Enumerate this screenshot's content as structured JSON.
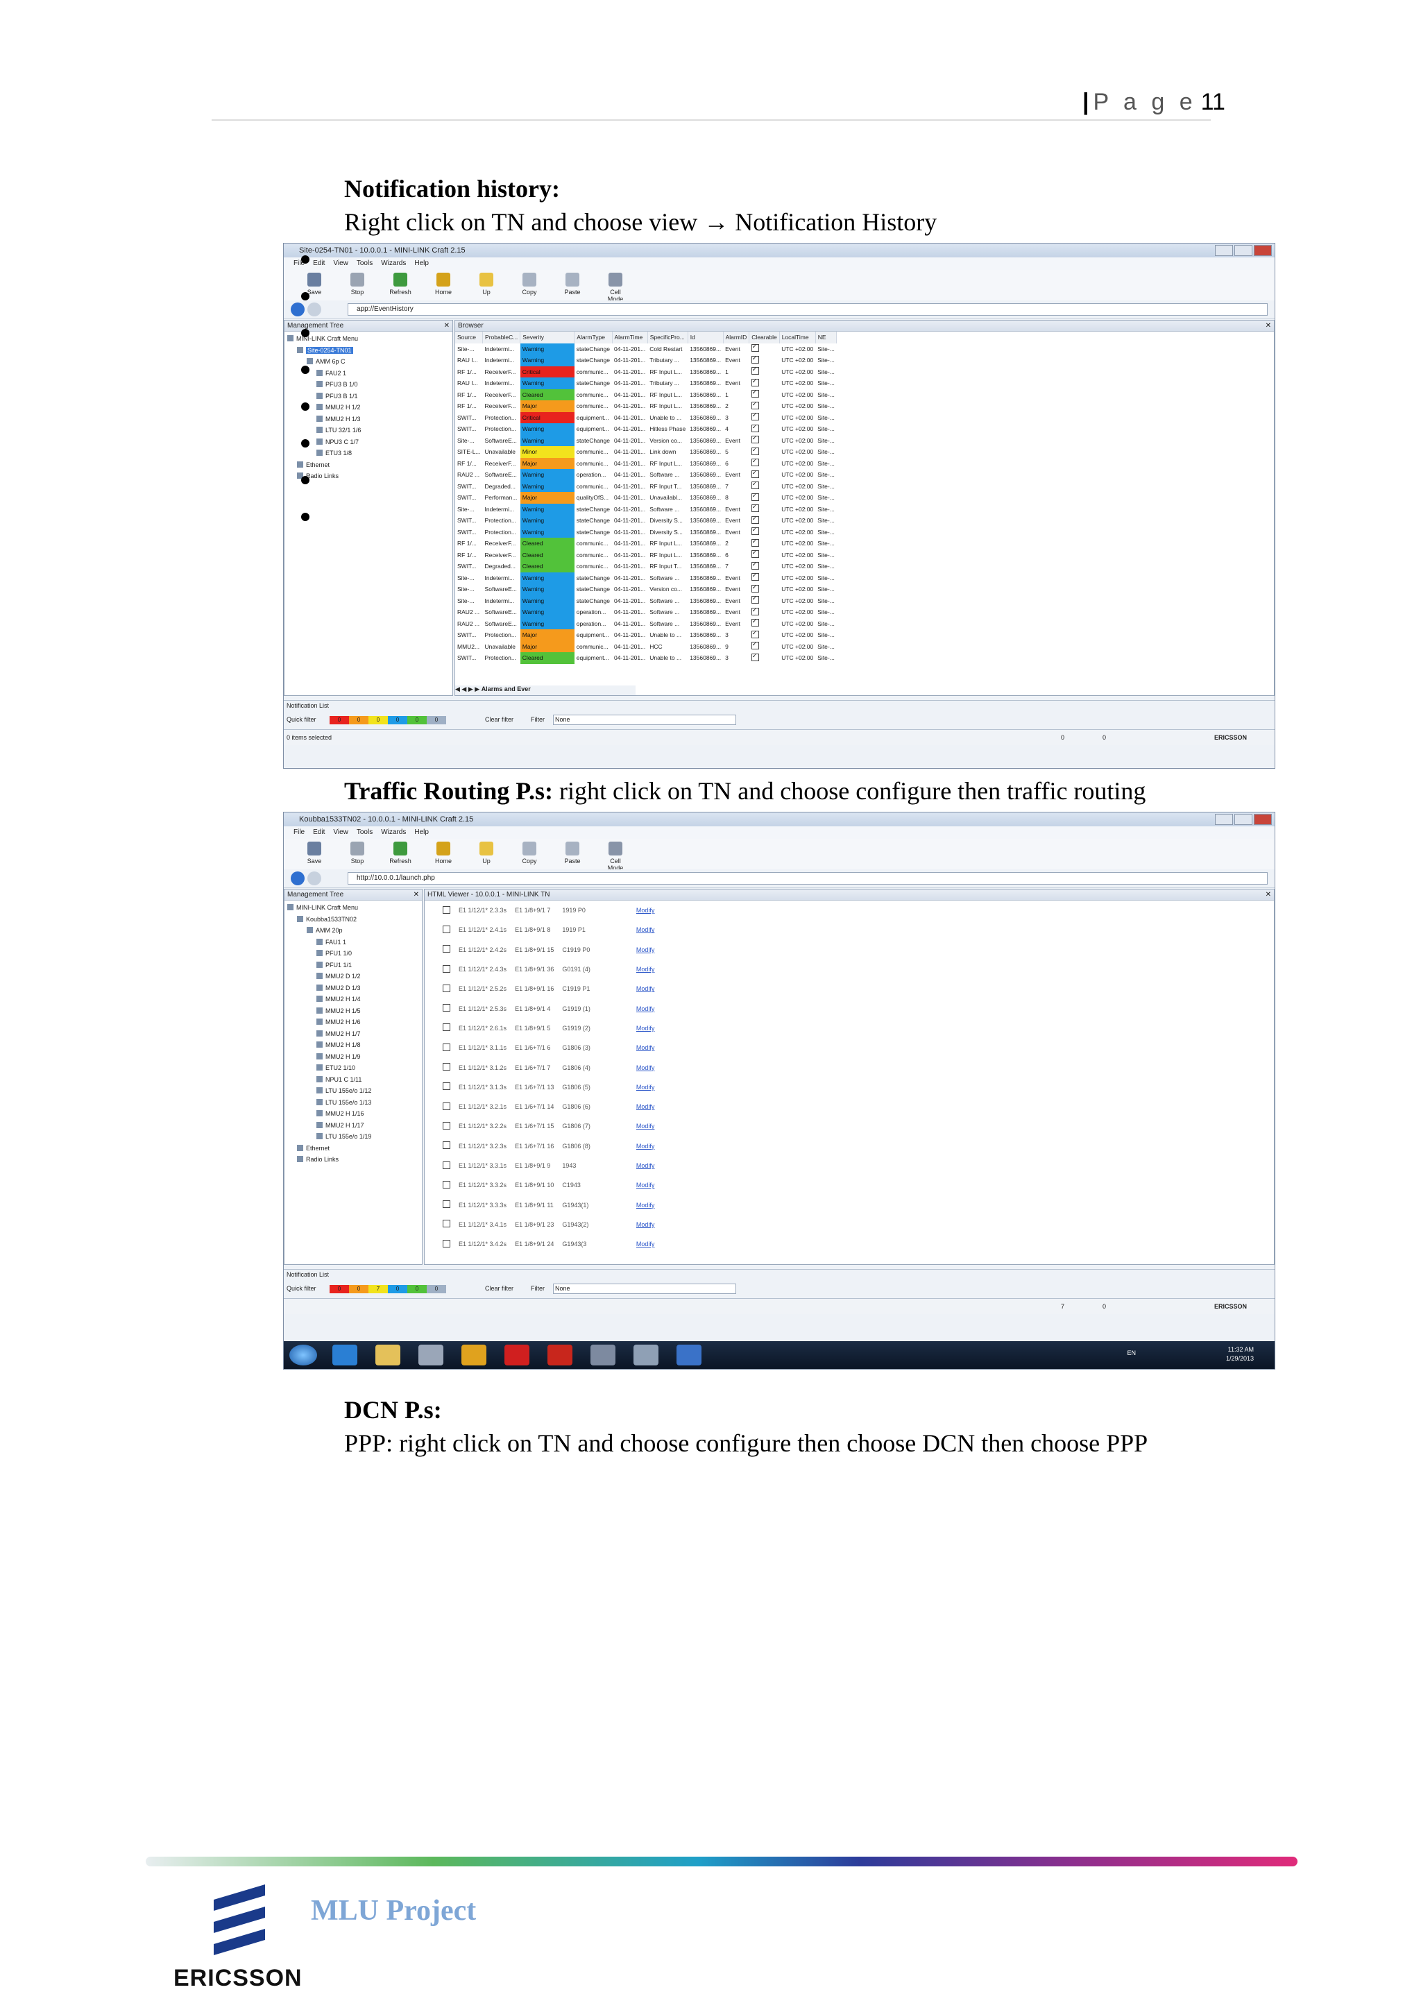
{
  "header": {
    "page_label": "P a g e",
    "page_number": "11"
  },
  "section1": {
    "heading": "Notification history:",
    "instruction": "Right click on TN and choose view",
    "arrow": "→",
    "target": "Notification History"
  },
  "window1": {
    "title": "Site-0254-TN01 - 10.0.0.1 - MINI-LINK Craft 2.15",
    "menu": [
      "File",
      "Edit",
      "View",
      "Tools",
      "Wizards",
      "Help"
    ],
    "toolbar": [
      "Save",
      "Stop",
      "Refresh",
      "Home",
      "Up",
      "Copy",
      "Paste",
      "Cell Mode"
    ],
    "address": "app://EventHistory",
    "tree_title": "Management Tree",
    "tree": [
      "MINI-LINK Craft Menu",
      "Site-0254-TN01",
      "AMM 6p C",
      "FAU2 1",
      "PFU3 B 1/0",
      "PFU3 B 1/1",
      "MMU2 H 1/2",
      "MMU2 H 1/3",
      "LTU 32/1 1/6",
      "NPU3 C 1/7",
      "ETU3 1/8",
      "Ethernet",
      "Radio Links"
    ],
    "browser_title": "Browser",
    "columns": [
      "Source",
      "ProbableC...",
      "Severity",
      "AlarmType",
      "AlarmTime",
      "SpecificPro...",
      "Id",
      "AlarmID",
      "Clearable",
      "LocalTime",
      "NE"
    ],
    "rows": [
      [
        "Site-...",
        "Indetermi...",
        "Warning",
        "stateChange",
        "04-11-201...",
        "Cold Restart",
        "13560869...",
        "Event",
        "UTC +02:00",
        "Site-..."
      ],
      [
        "RAU I...",
        "Indetermi...",
        "Warning",
        "stateChange",
        "04-11-201...",
        "Tributary ...",
        "13560869...",
        "Event",
        "UTC +02:00",
        "Site-..."
      ],
      [
        "RF 1/...",
        "ReceiverF...",
        "Critical",
        "communic...",
        "04-11-201...",
        "RF Input L...",
        "13560869...",
        "1",
        "UTC +02:00",
        "Site-..."
      ],
      [
        "RAU I...",
        "Indetermi...",
        "Warning",
        "stateChange",
        "04-11-201...",
        "Tributary ...",
        "13560869...",
        "Event",
        "UTC +02:00",
        "Site-..."
      ],
      [
        "RF 1/...",
        "ReceiverF...",
        "Cleared",
        "communic...",
        "04-11-201...",
        "RF Input L...",
        "13560869...",
        "1",
        "UTC +02:00",
        "Site-..."
      ],
      [
        "RF 1/...",
        "ReceiverF...",
        "Major",
        "communic...",
        "04-11-201...",
        "RF Input L...",
        "13560869...",
        "2",
        "UTC +02:00",
        "Site-..."
      ],
      [
        "SWIT...",
        "Protection...",
        "Critical",
        "equipment...",
        "04-11-201...",
        "Unable to ...",
        "13560869...",
        "3",
        "UTC +02:00",
        "Site-..."
      ],
      [
        "SWIT...",
        "Protection...",
        "Warning",
        "equipment...",
        "04-11-201...",
        "Hitless Phase",
        "13560869...",
        "4",
        "UTC +02:00",
        "Site-..."
      ],
      [
        "Site-...",
        "SoftwareE...",
        "Warning",
        "stateChange",
        "04-11-201...",
        "Version co...",
        "13560869...",
        "Event",
        "UTC +02:00",
        "Site-..."
      ],
      [
        "SITE-L...",
        "Unavailable",
        "Minor",
        "communic...",
        "04-11-201...",
        "Link down",
        "13560869...",
        "5",
        "UTC +02:00",
        "Site-..."
      ],
      [
        "RF 1/...",
        "ReceiverF...",
        "Major",
        "communic...",
        "04-11-201...",
        "RF Input L...",
        "13560869...",
        "6",
        "UTC +02:00",
        "Site-..."
      ],
      [
        "RAU2 ...",
        "SoftwareE...",
        "Warning",
        "operation...",
        "04-11-201...",
        "Software ...",
        "13560869...",
        "Event",
        "UTC +02:00",
        "Site-..."
      ],
      [
        "SWIT...",
        "Degraded...",
        "Warning",
        "communic...",
        "04-11-201...",
        "RF Input T...",
        "13560869...",
        "7",
        "UTC +02:00",
        "Site-..."
      ],
      [
        "SWIT...",
        "Performan...",
        "Major",
        "qualityOfS...",
        "04-11-201...",
        "Unavailabl...",
        "13560869...",
        "8",
        "UTC +02:00",
        "Site-..."
      ],
      [
        "Site-...",
        "Indetermi...",
        "Warning",
        "stateChange",
        "04-11-201...",
        "Software ...",
        "13560869...",
        "Event",
        "UTC +02:00",
        "Site-..."
      ],
      [
        "SWIT...",
        "Protection...",
        "Warning",
        "stateChange",
        "04-11-201...",
        "Diversity S...",
        "13560869...",
        "Event",
        "UTC +02:00",
        "Site-..."
      ],
      [
        "SWIT...",
        "Protection...",
        "Warning",
        "stateChange",
        "04-11-201...",
        "Diversity S...",
        "13560869...",
        "Event",
        "UTC +02:00",
        "Site-..."
      ],
      [
        "RF 1/...",
        "ReceiverF...",
        "Cleared",
        "communic...",
        "04-11-201...",
        "RF Input L...",
        "13560869...",
        "2",
        "UTC +02:00",
        "Site-..."
      ],
      [
        "RF 1/...",
        "ReceiverF...",
        "Cleared",
        "communic...",
        "04-11-201...",
        "RF Input L...",
        "13560869...",
        "6",
        "UTC +02:00",
        "Site-..."
      ],
      [
        "SWIT...",
        "Degraded...",
        "Cleared",
        "communic...",
        "04-11-201...",
        "RF Input T...",
        "13560869...",
        "7",
        "UTC +02:00",
        "Site-..."
      ],
      [
        "Site-...",
        "Indetermi...",
        "Warning",
        "stateChange",
        "04-11-201...",
        "Software ...",
        "13560869...",
        "Event",
        "UTC +02:00",
        "Site-..."
      ],
      [
        "Site-...",
        "SoftwareE...",
        "Warning",
        "stateChange",
        "04-11-201...",
        "Version co...",
        "13560869...",
        "Event",
        "UTC +02:00",
        "Site-..."
      ],
      [
        "Site-...",
        "Indetermi...",
        "Warning",
        "stateChange",
        "04-11-201...",
        "Software ...",
        "13560869...",
        "Event",
        "UTC +02:00",
        "Site-..."
      ],
      [
        "RAU2 ...",
        "SoftwareE...",
        "Warning",
        "operation...",
        "04-11-201...",
        "Software ...",
        "13560869...",
        "Event",
        "UTC +02:00",
        "Site-..."
      ],
      [
        "RAU2 ...",
        "SoftwareE...",
        "Warning",
        "operation...",
        "04-11-201...",
        "Software ...",
        "13560869...",
        "Event",
        "UTC +02:00",
        "Site-..."
      ],
      [
        "SWIT...",
        "Protection...",
        "Major",
        "equipment...",
        "04-11-201...",
        "Unable to ...",
        "13560869...",
        "3",
        "UTC +02:00",
        "Site-..."
      ],
      [
        "MMU2...",
        "Unavailable",
        "Major",
        "communic...",
        "04-11-201...",
        "HCC",
        "13560869...",
        "9",
        "UTC +02:00",
        "Site-..."
      ],
      [
        "SWIT...",
        "Protection...",
        "Cleared",
        "equipment...",
        "04-11-201...",
        "Unable to ...",
        "13560869...",
        "3",
        "UTC +02:00",
        "Site-..."
      ]
    ],
    "tab_label": "Alarms and Ever",
    "notif_title": "Notification List",
    "quick_filter": "Quick filter",
    "qf_values": [
      "0",
      "0",
      "0",
      "0",
      "0",
      "0"
    ],
    "clear_filter": "Clear filter",
    "filter_label": "Filter",
    "filter_value": "None",
    "status": "0 items selected",
    "badge_left": "0",
    "badge_right": "0",
    "brand": "ERICSSON"
  },
  "section2": {
    "heading": "Traffic Routing P.s:",
    "instruction": " right click on TN and choose configure then traffic routing"
  },
  "window2": {
    "title": "Koubba1533TN02 - 10.0.0.1 - MINI-LINK Craft 2.15",
    "menu": [
      "File",
      "Edit",
      "View",
      "Tools",
      "Wizards",
      "Help"
    ],
    "toolbar": [
      "Save",
      "Stop",
      "Refresh",
      "Home",
      "Up",
      "Copy",
      "Paste",
      "Cell Mode"
    ],
    "address": "http://10.0.0.1/launch.php",
    "tree_title": "Management Tree",
    "tree": [
      "MINI-LINK Craft Menu",
      "Koubba1533TN02",
      "AMM 20p",
      "FAU1 1",
      "PFU1 1/0",
      "PFU1 1/1",
      "MMU2 D 1/2",
      "MMU2 D 1/3",
      "MMU2 H 1/4",
      "MMU2 H 1/5",
      "MMU2 H 1/6",
      "MMU2 H 1/7",
      "MMU2 H 1/8",
      "MMU2 H 1/9",
      "ETU2 1/10",
      "NPU1 C 1/11",
      "LTU 155e/o 1/12",
      "LTU 155e/o 1/13",
      "MMU2 H 1/16",
      "MMU2 H 1/17",
      "LTU 155e/o 1/19",
      "Ethernet",
      "Radio Links"
    ],
    "viewer_title": "HTML Viewer - 10.0.0.1 - MINI-LINK TN",
    "routes": [
      [
        "E1 1/12/1* 2.3.3s",
        "E1 1/8+9/1 7",
        "1919 P0",
        "Modify"
      ],
      [
        "E1 1/12/1* 2.4.1s",
        "E1 1/8+9/1 8",
        "1919 P1",
        "Modify"
      ],
      [
        "E1 1/12/1* 2.4.2s",
        "E1 1/8+9/1 15",
        "C1919 P0",
        "Modify"
      ],
      [
        "E1 1/12/1* 2.4.3s",
        "E1 1/8+9/1 36",
        "G0191 (4)",
        "Modify"
      ],
      [
        "E1 1/12/1* 2.5.2s",
        "E1 1/8+9/1 16",
        "C1919 P1",
        "Modify"
      ],
      [
        "E1 1/12/1* 2.5.3s",
        "E1 1/8+9/1 4",
        "G1919 (1)",
        "Modify"
      ],
      [
        "E1 1/12/1* 2.6.1s",
        "E1 1/8+9/1 5",
        "G1919 (2)",
        "Modify"
      ],
      [
        "E1 1/12/1* 3.1.1s",
        "E1 1/6+7/1 6",
        "G1806 (3)",
        "Modify"
      ],
      [
        "E1 1/12/1* 3.1.2s",
        "E1 1/6+7/1 7",
        "G1806 (4)",
        "Modify"
      ],
      [
        "E1 1/12/1* 3.1.3s",
        "E1 1/6+7/1 13",
        "G1806 (5)",
        "Modify"
      ],
      [
        "E1 1/12/1* 3.2.1s",
        "E1 1/6+7/1 14",
        "G1806 (6)",
        "Modify"
      ],
      [
        "E1 1/12/1* 3.2.2s",
        "E1 1/6+7/1 15",
        "G1806 (7)",
        "Modify"
      ],
      [
        "E1 1/12/1* 3.2.3s",
        "E1 1/6+7/1 16",
        "G1806 (8)",
        "Modify"
      ],
      [
        "E1 1/12/1* 3.3.1s",
        "E1 1/8+9/1 9",
        "1943",
        "Modify"
      ],
      [
        "E1 1/12/1* 3.3.2s",
        "E1 1/8+9/1 10",
        "C1943",
        "Modify"
      ],
      [
        "E1 1/12/1* 3.3.3s",
        "E1 1/8+9/1 11",
        "G1943(1)",
        "Modify"
      ],
      [
        "E1 1/12/1* 3.4.1s",
        "E1 1/8+9/1 23",
        "G1943(2)",
        "Modify"
      ],
      [
        "E1 1/12/1* 3.4.2s",
        "E1 1/8+9/1 24",
        "G1943(3",
        "Modify"
      ]
    ],
    "notif_title": "Notification List",
    "quick_filter": "Quick filter",
    "qf_values": [
      "0",
      "0",
      "7",
      "0",
      "0",
      "0"
    ],
    "clear_filter": "Clear filter",
    "filter_label": "Filter",
    "filter_value": "None",
    "badge_left": "7",
    "badge_right": "0",
    "brand": "ERICSSON",
    "lang": "EN",
    "time": "11:32 AM",
    "date": "1/29/2013"
  },
  "section3": {
    "heading": "DCN P.s:",
    "instruction": "PPP: right click on TN and choose configure then choose DCN then choose PPP"
  },
  "footer": {
    "project": "MLU Project",
    "brand": "ERICSSON"
  },
  "colors": {
    "warning": "#1e9be6",
    "critical": "#e8231e",
    "major": "#f59a1c",
    "minor": "#f2e31d",
    "cleared": "#52c23a",
    "accent": "#7ea6d6"
  }
}
